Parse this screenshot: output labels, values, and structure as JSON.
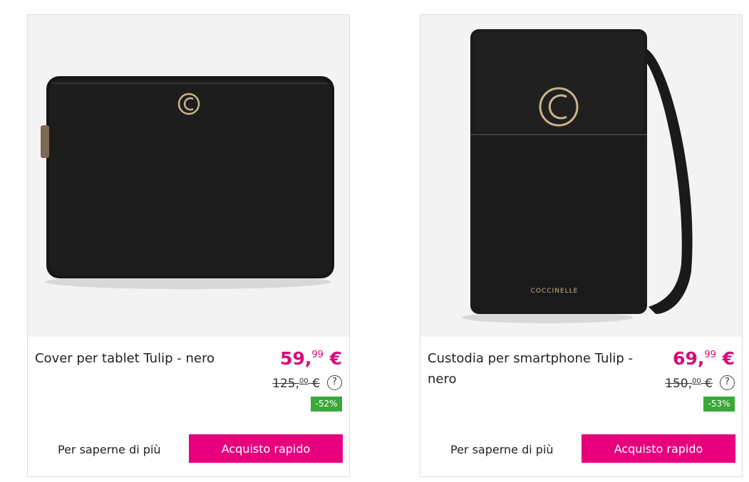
{
  "products": [
    {
      "title": "Cover per tablet Tulip - nero",
      "price_main": "59,",
      "price_cents": "99",
      "price_currency": " €",
      "old_price_main": "125,",
      "old_price_cents": "00",
      "old_price_currency": " €",
      "help_icon": "?",
      "discount": "-52%",
      "more_label": "Per saperne di più",
      "buy_label": "Acquisto rapido"
    },
    {
      "title": "Custodia per smartphone Tulip - nero",
      "price_main": "69,",
      "price_cents": "99",
      "price_currency": " €",
      "old_price_main": "150,",
      "old_price_cents": "00",
      "old_price_currency": " €",
      "help_icon": "?",
      "discount": "-53%",
      "more_label": "Per saperne di più",
      "buy_label": "Acquisto rapido",
      "brand_text": "COCCINELLE"
    }
  ],
  "colors": {
    "price": "#d9087b",
    "button": "#e6007e",
    "discount": "#3ba83a"
  }
}
